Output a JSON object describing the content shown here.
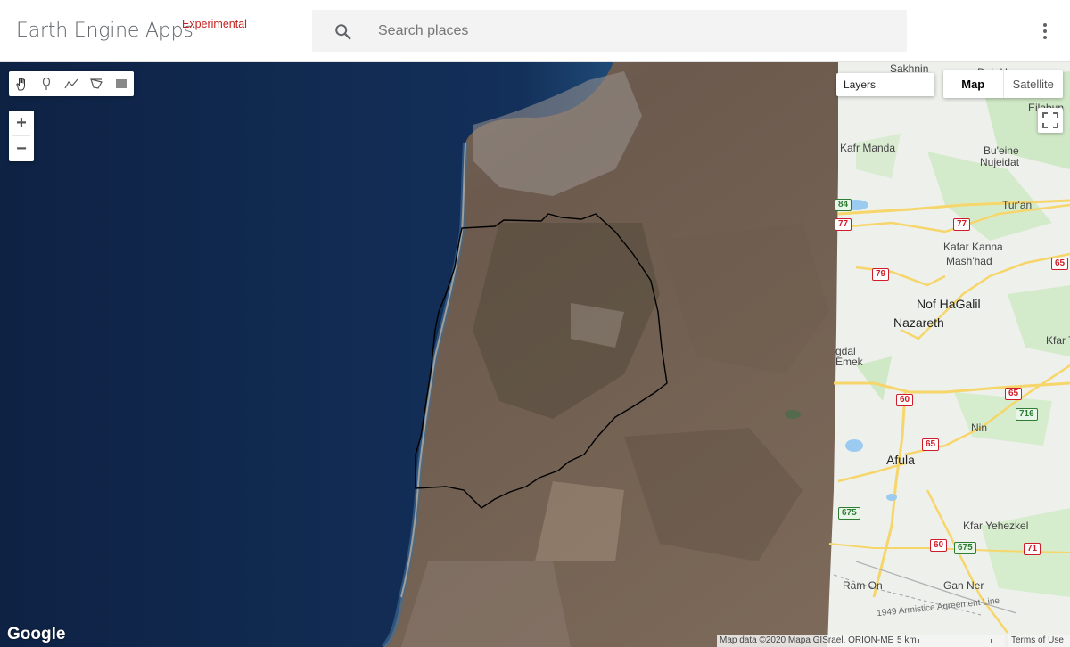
{
  "header": {
    "title": "Earth Engine Apps",
    "badge": "Experimental",
    "search_placeholder": "Search places",
    "search_icon": "search-icon",
    "menu_icon": "more-vert-icon"
  },
  "map": {
    "draw_tools": [
      "hand-icon",
      "marker-icon",
      "line-icon",
      "polygon-icon",
      "rectangle-icon"
    ],
    "zoom_in": "+",
    "zoom_out": "−",
    "layers_label": "Layers",
    "map_type_map": "Map",
    "map_type_satellite": "Satellite",
    "google_logo": "Google",
    "attribution": "Map data ©2020 Mapa GISrael, ORION-ME",
    "scale_label": "5 km",
    "terms": "Terms of Use",
    "places": {
      "sakhnin": "Sakhnin",
      "deir_hana": "Deir Hana",
      "eilabun": "Eilabun",
      "kafr_manda": "Kafr Manda",
      "bueine": "Bu'eine",
      "nujeidat": "Nujeidat",
      "turan": "Tur'an",
      "kafar_kanna": "Kafar Kanna",
      "mashhad": "Mash'had",
      "nof_hagalil": "Nof HaGalil",
      "nazareth": "Nazareth",
      "kfar_t": "Kfar T",
      "gdal": "gdal",
      "emek": "Emek",
      "nin": "Nin",
      "afula": "Afula",
      "kfar_yehezkel": "Kfar Yehezkel",
      "ram_on": "Ram On",
      "gan_ner": "Gan Ner",
      "armistice": "1949 Armistice Agreement Line"
    },
    "routes": {
      "r84": "84",
      "r77a": "77",
      "r77b": "77",
      "r79": "79",
      "r65a": "65",
      "r60a": "60",
      "r65b": "65",
      "r716": "716",
      "r65c": "65",
      "r675a": "675",
      "r60b": "60",
      "r675b": "675",
      "r71": "71"
    }
  }
}
